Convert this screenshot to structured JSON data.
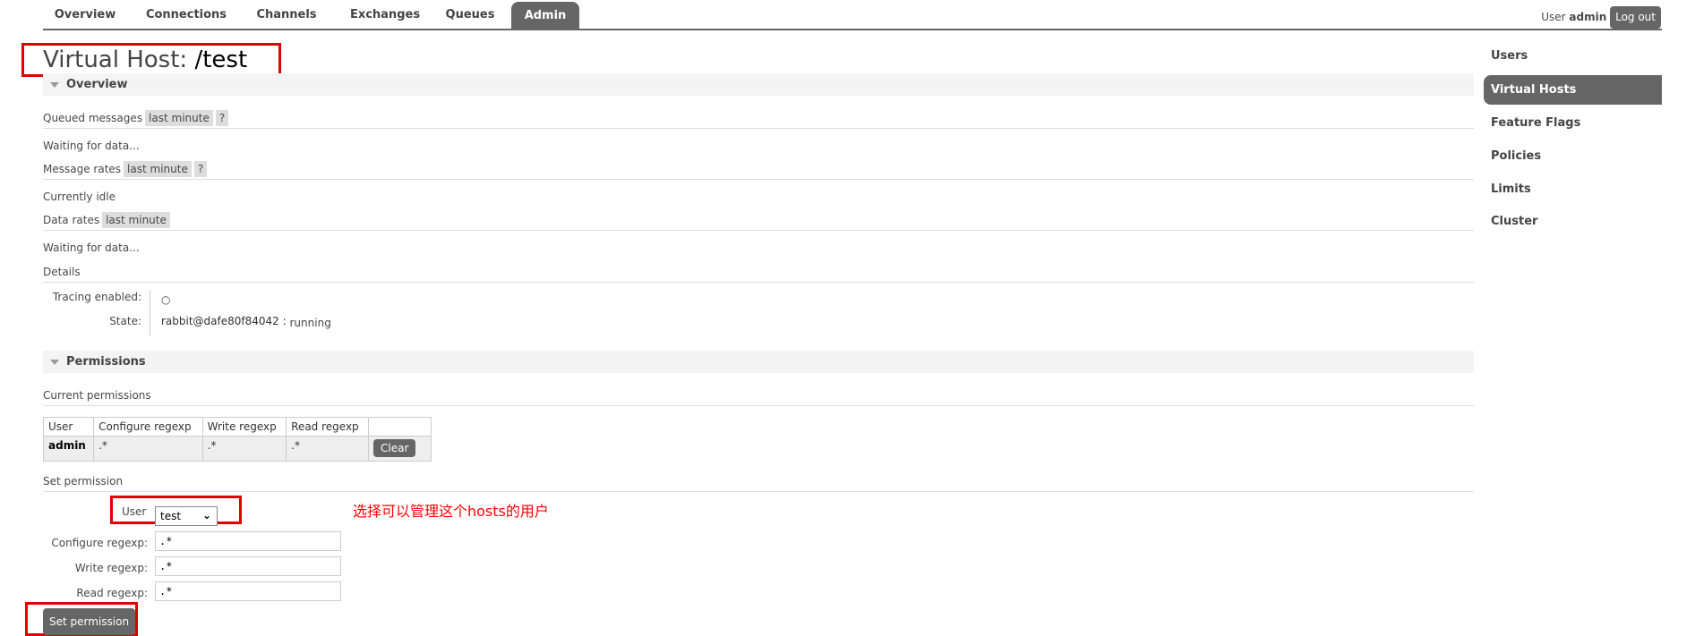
{
  "nav": {
    "tabs": [
      "Overview",
      "Connections",
      "Channels",
      "Exchanges",
      "Queues",
      "Admin"
    ],
    "active": "Admin"
  },
  "user": {
    "prefix": "User",
    "name": "admin",
    "logout": "Log out"
  },
  "page": {
    "title_prefix": "Virtual Host:",
    "title_name": "/test"
  },
  "overview": {
    "header": "Overview",
    "queued_label": "Queued messages",
    "queued_range": "last minute",
    "help": "?",
    "waiting1": "Waiting for data...",
    "rates_label": "Message rates",
    "rates_range": "last minute",
    "idle": "Currently idle",
    "data_label": "Data rates",
    "data_range": "last minute",
    "waiting2": "Waiting for data..."
  },
  "details": {
    "header": "Details",
    "tracing_label": "Tracing enabled:",
    "tracing_value": "○",
    "state_label": "State:",
    "state_node": "rabbit@dafe80f84042 :",
    "state_value": "running"
  },
  "permissions": {
    "header": "Permissions",
    "current": "Current permissions",
    "columns": [
      "User",
      "Configure regexp",
      "Write regexp",
      "Read regexp",
      ""
    ],
    "rows": [
      {
        "user": "admin",
        "configure": ".*",
        "write": ".*",
        "read": ".*",
        "action": "Clear"
      }
    ],
    "set_header": "Set permission",
    "user_label": "User",
    "user_selected": "test",
    "configure_label": "Configure regexp:",
    "configure_value": ".*",
    "write_label": "Write regexp:",
    "write_value": ".*",
    "read_label": "Read regexp:",
    "read_value": ".*",
    "submit": "Set permission"
  },
  "annotation": "选择可以管理这个hosts的用户",
  "annotation_color": "#ff0000",
  "sidebar": {
    "items": [
      "Users",
      "Virtual Hosts",
      "Feature Flags",
      "Policies",
      "Limits",
      "Cluster"
    ],
    "active": "Virtual Hosts"
  }
}
